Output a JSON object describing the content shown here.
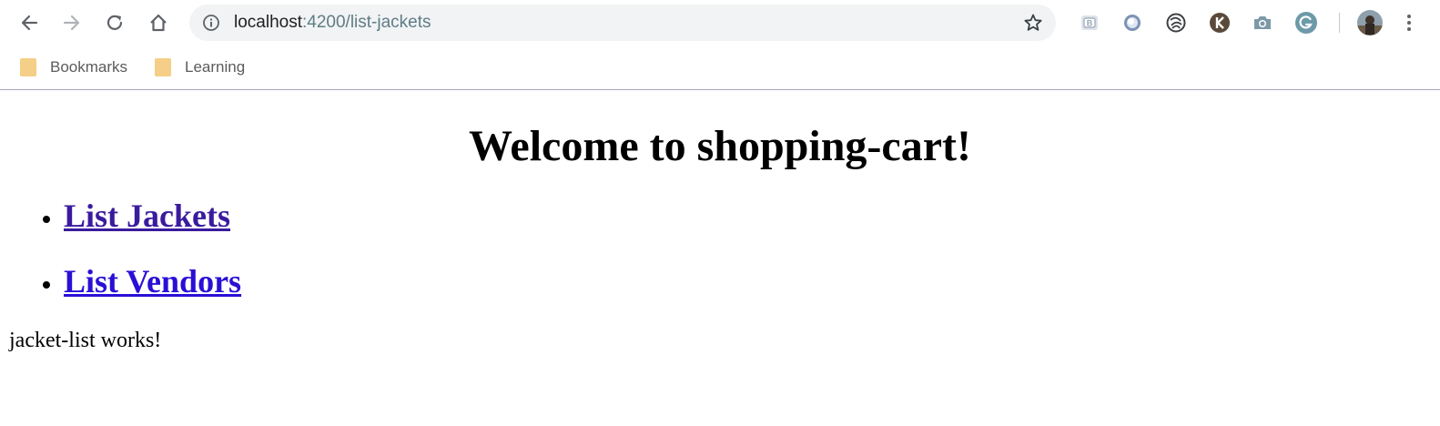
{
  "browser": {
    "url_host": "localhost",
    "url_path": ":4200/list-jackets",
    "bookmarks": [
      {
        "label": "Bookmarks",
        "icon": "folder-icon"
      },
      {
        "label": "Learning",
        "icon": "folder-icon"
      }
    ],
    "extensions": [
      "bitwarden-icon",
      "circle-extension-icon",
      "swirl-extension-icon",
      "k-extension-icon",
      "camera-icon",
      "grammarly-icon"
    ],
    "colors": {
      "omnibox_bg": "#f1f3f4",
      "folder": "#f5cf87"
    }
  },
  "page": {
    "title": "Welcome to shopping-cart!",
    "links": [
      {
        "label": "List Jackets",
        "color": "#3a1b9e"
      },
      {
        "label": "List Vendors",
        "color": "#2a0fd6"
      }
    ],
    "status": "jacket-list works!"
  }
}
